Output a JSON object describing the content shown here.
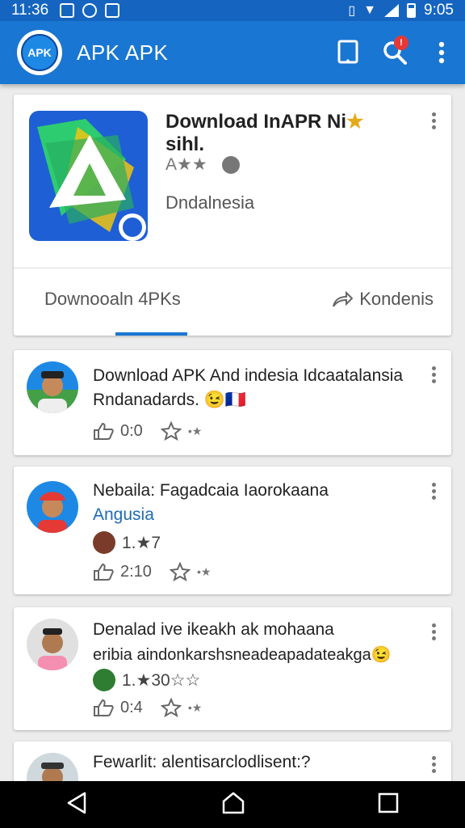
{
  "status_bar": {
    "time_left": "11:36",
    "time_right": "9:05"
  },
  "app_bar": {
    "title": "APK  APK",
    "notification_count": "!"
  },
  "app_card": {
    "title": "Download InAPR Ni",
    "title_line2": "sihl.",
    "rating": "A★★",
    "developer": "Dndalnesia",
    "tab_left": "Downooaln 4PKs",
    "tab_right": "Kondenis"
  },
  "posts": [
    {
      "title": "Download APK And indesia Idcaatalansia",
      "subtitle": "Rndanadards.",
      "subtitle_emoji": "😉🇫🇷",
      "like_count": "0:0"
    },
    {
      "title": "Nebaila: Fagadcaia Iaorokaana",
      "subtitle": "Angusia",
      "mini_text": "1.★7",
      "like_count": "2:10"
    },
    {
      "title": "Denalad ive ikeakh ak mohaana",
      "subtitle": "eribia aindonkarshsneadeapadateakga",
      "subtitle_emoji": "😉",
      "mini_text": "1.★30☆☆",
      "like_count": "0:4"
    },
    {
      "title": "Fewarlit: alentisarclodlisent:?"
    }
  ],
  "colors": {
    "primary": "#1976d2",
    "status_bar": "#1565c0",
    "accent_blue": "#1e6bb8"
  },
  "icons": [
    "gallery-icon",
    "shield-icon",
    "notification-icon",
    "vibrate-icon",
    "wifi-icon",
    "signal-icon",
    "battery-icon",
    "bookmark-icon",
    "search-icon",
    "more-vert-icon",
    "share-icon",
    "thumb-up-icon",
    "star-icon",
    "back-icon",
    "home-icon",
    "recents-icon"
  ]
}
